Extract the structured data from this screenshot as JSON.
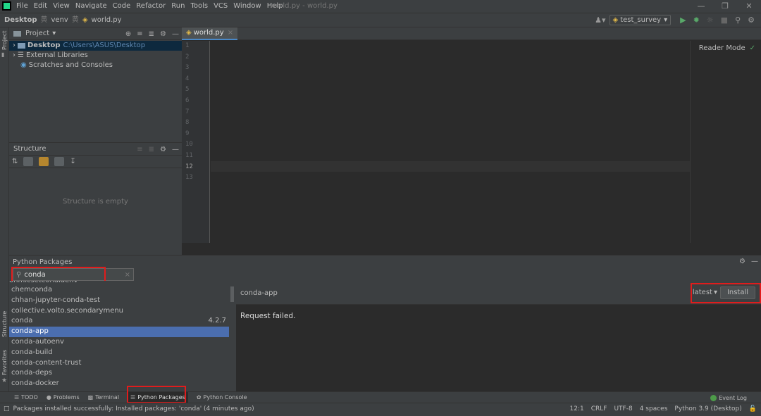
{
  "menubar": {
    "items": [
      "File",
      "Edit",
      "View",
      "Navigate",
      "Code",
      "Refactor",
      "Run",
      "Tools",
      "VCS",
      "Window",
      "Help"
    ],
    "window_title": "world.py - world.py"
  },
  "navbar": {
    "crumb_root": "Desktop",
    "crumb_dir": "venv",
    "crumb_file": "world.py",
    "run_config": "test_survey"
  },
  "leftstrip": {
    "project_label": "Project",
    "structure_label": "Structure",
    "favorites_label": "Favorites"
  },
  "project": {
    "title": "Project",
    "tree": [
      {
        "label": "Desktop",
        "path": "C:\\Users\\ASUS\\Desktop"
      },
      {
        "label": "External Libraries"
      },
      {
        "label": "Scratches and Consoles"
      }
    ]
  },
  "structure": {
    "title": "Structure",
    "empty_text": "Structure is empty"
  },
  "editor": {
    "tab_label": "world.py",
    "line_numbers": [
      "1",
      "2",
      "3",
      "4",
      "5",
      "6",
      "7",
      "8",
      "9",
      "10",
      "11",
      "12",
      "13"
    ],
    "current_line": "12",
    "reader_mode": "Reader Mode"
  },
  "packages": {
    "title": "Python Packages",
    "search_value": "conda",
    "list_cut_item": "ohmicsetcondiaenv",
    "list": [
      {
        "name": "chemconda",
        "version": ""
      },
      {
        "name": "chhan-jupyter-conda-test",
        "version": ""
      },
      {
        "name": "collective.volto.secondarymenu",
        "version": ""
      },
      {
        "name": "conda",
        "version": "4.2.7"
      },
      {
        "name": "conda-app",
        "version": "",
        "selected": true
      },
      {
        "name": "conda-autoenv",
        "version": ""
      },
      {
        "name": "conda-build",
        "version": ""
      },
      {
        "name": "conda-content-trust",
        "version": ""
      },
      {
        "name": "conda-deps",
        "version": ""
      },
      {
        "name": "conda-docker",
        "version": ""
      }
    ],
    "detail": {
      "name": "conda-app",
      "version_select": "latest",
      "install_label": "Install",
      "message": "Request failed."
    }
  },
  "tooltabs": {
    "todo": "TODO",
    "problems": "Problems",
    "terminal": "Terminal",
    "python_packages": "Python Packages",
    "python_console": "Python Console",
    "event_log": "Event Log"
  },
  "status": {
    "message": "Packages installed successfully: Installed packages: 'conda' (4 minutes ago)",
    "position": "12:1",
    "line_sep": "CRLF",
    "encoding": "UTF-8",
    "indent": "4 spaces",
    "interpreter": "Python 3.9 (Desktop)"
  },
  "colors": {
    "highlight_box": "#e01c1c",
    "selection": "#4b6eaf",
    "run_green": "#59a869"
  }
}
